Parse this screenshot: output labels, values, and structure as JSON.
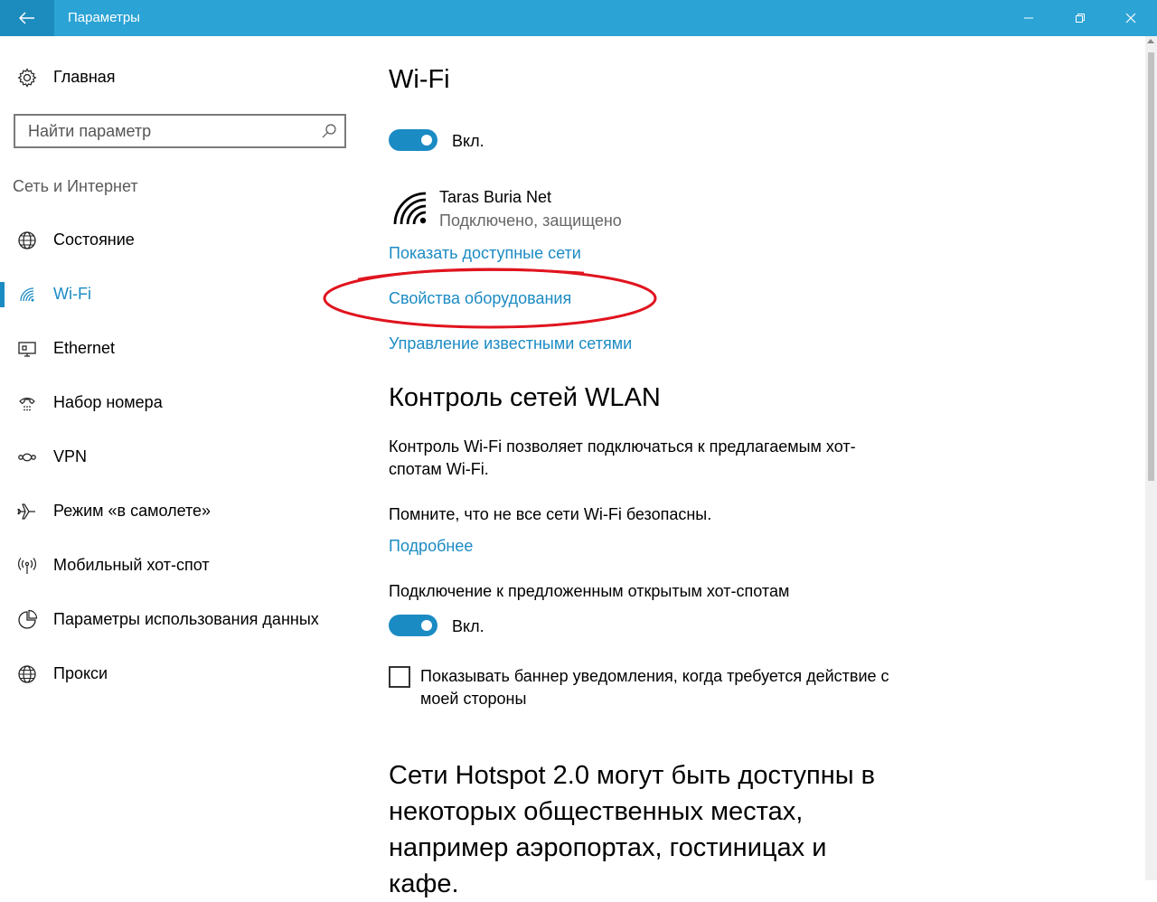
{
  "window": {
    "title": "Параметры"
  },
  "sidebar": {
    "home_label": "Главная",
    "search_placeholder": "Найти параметр",
    "group_title": "Сеть и Интернет",
    "items": [
      {
        "label": "Состояние",
        "icon": "globe-network-icon"
      },
      {
        "label": "Wi-Fi",
        "icon": "wifi-icon",
        "active": true
      },
      {
        "label": "Ethernet",
        "icon": "ethernet-monitor-icon"
      },
      {
        "label": "Набор номера",
        "icon": "dialup-phone-icon"
      },
      {
        "label": "VPN",
        "icon": "vpn-icon"
      },
      {
        "label": "Режим «в самолете»",
        "icon": "airplane-icon"
      },
      {
        "label": "Мобильный хот-спот",
        "icon": "hotspot-antenna-icon"
      },
      {
        "label": "Параметры использования данных",
        "icon": "data-usage-pie-icon"
      },
      {
        "label": "Прокси",
        "icon": "globe-proxy-icon"
      }
    ]
  },
  "main": {
    "title": "Wi-Fi",
    "wifi_toggle": {
      "label": "Вкл.",
      "on": true
    },
    "network": {
      "name": "Taras Buria Net",
      "status": "Подключено, защищено"
    },
    "links": {
      "show_networks": "Показать доступные сети",
      "hardware_properties": "Свойства оборудования",
      "manage_known": "Управление известными сетями"
    },
    "wlan_section": {
      "title": "Контроль сетей WLAN",
      "description": "Контроль Wi-Fi позволяет подключаться к предлагаемым хот-спотам Wi-Fi.",
      "warning": "Помните, что не все сети Wi-Fi безопасны.",
      "more_link": "Подробнее",
      "open_hotspots_label": "Подключение к предложенным открытым хот-спотам",
      "open_hotspots_toggle": {
        "label": "Вкл.",
        "on": true
      },
      "banner_checkbox_label": "Показывать баннер уведомления, когда требуется действие с моей стороны",
      "banner_checkbox_checked": false
    },
    "hotspot_section": {
      "title": "Сети Hotspot 2.0 могут быть доступны в некоторых общественных местах, например аэропортах, гостиницах и кафе."
    }
  },
  "colors": {
    "titlebar": "#2ba3d5",
    "accent": "#1b8bc4",
    "annotation": "#e0141e"
  }
}
